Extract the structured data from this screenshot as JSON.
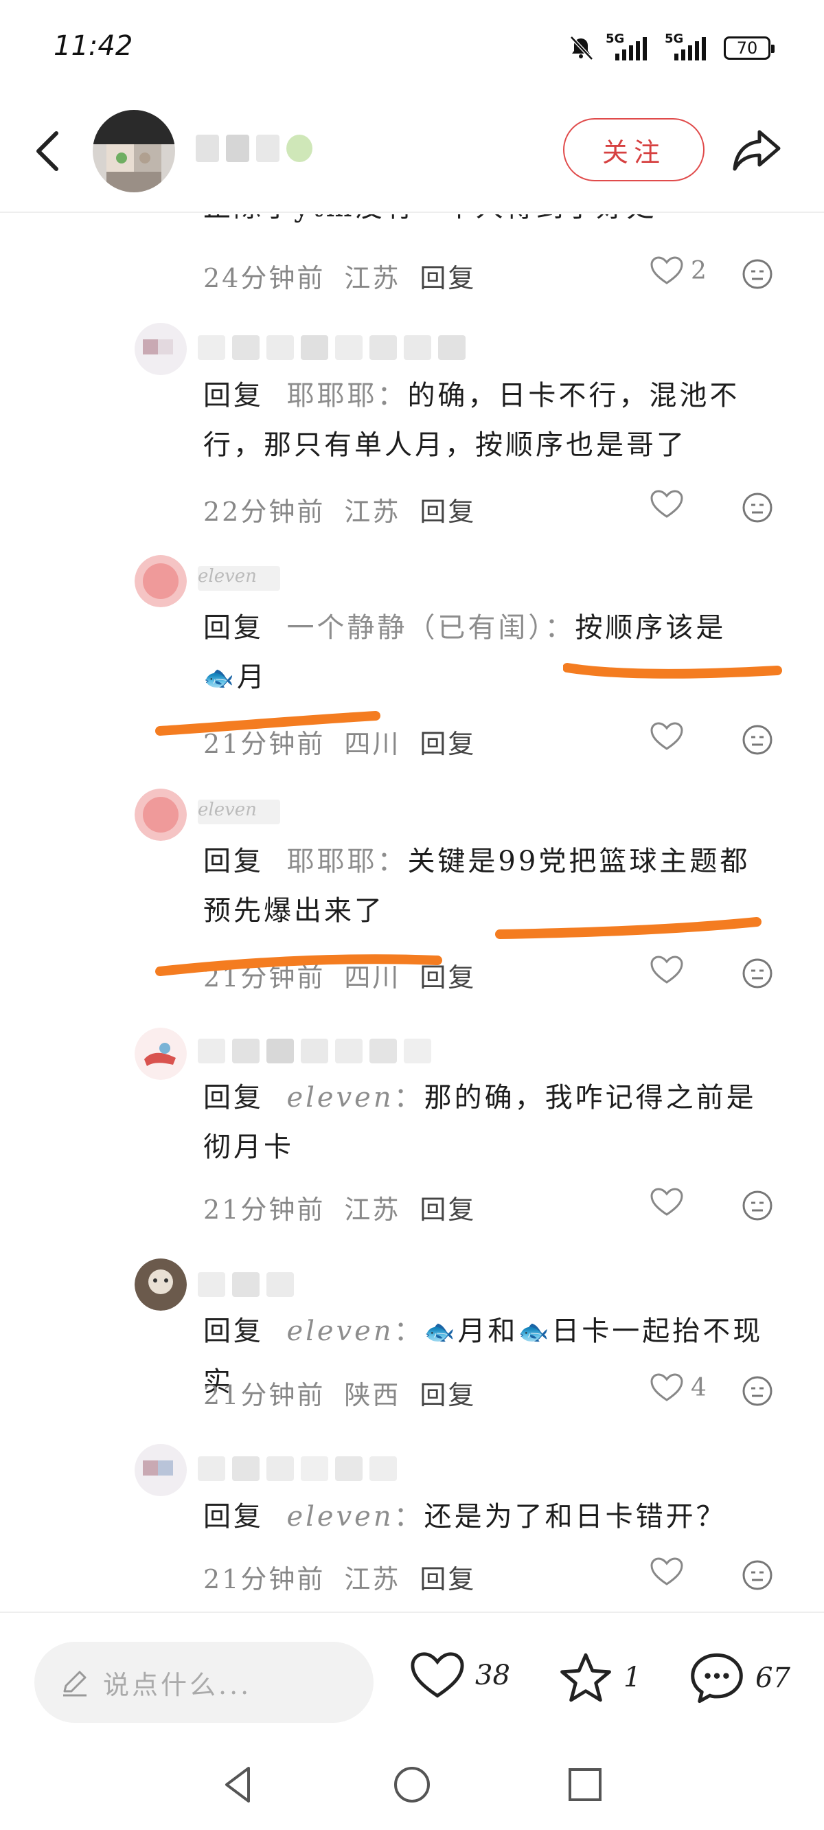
{
  "status": {
    "time": "11:42",
    "network1": "5G",
    "network2": "5G",
    "battery": "70"
  },
  "header": {
    "follow_label": "关注"
  },
  "comments": [
    {
      "text": "止除了ytm没有一个人得到了好处",
      "time": "24分钟前",
      "location": "江苏",
      "reply": "回复",
      "likes": "2"
    },
    {
      "prefix": "回复",
      "reply_to": "耶耶耶",
      "body": "的确，日卡不行，混池不行，那只有单人月，按顺序也是哥了",
      "time": "22分钟前",
      "location": "江苏",
      "reply": "回复"
    },
    {
      "author": "eleven",
      "prefix": "回复",
      "reply_to": "一个静静（已有闺）",
      "body_a": "按顺序该是",
      "body_b": "月",
      "time": "21分钟前",
      "location": "四川",
      "reply": "回复"
    },
    {
      "author": "eleven",
      "prefix": "回复",
      "reply_to": "耶耶耶",
      "body": "关键是99党把篮球主题都预先爆出来了",
      "time": "21分钟前",
      "location": "四川",
      "reply": "回复"
    },
    {
      "prefix": "回复",
      "reply_to": "eleven",
      "body": "那的确，我咋记得之前是彻月卡",
      "time": "21分钟前",
      "location": "江苏",
      "reply": "回复"
    },
    {
      "prefix": "回复",
      "reply_to": "eleven",
      "body_a": "月和",
      "body_b": "日卡一起抬不现实",
      "time": "21分钟前",
      "location": "陕西",
      "reply": "回复",
      "likes": "4"
    },
    {
      "prefix": "回复",
      "reply_to": "eleven",
      "body": "还是为了和日卡错开？",
      "time": "21分钟前",
      "location": "江苏",
      "reply": "回复"
    }
  ],
  "bottom": {
    "placeholder": "说点什么...",
    "likes": "38",
    "stars": "1",
    "comments": "67"
  },
  "icons": [
    "back-icon",
    "share-icon",
    "heart-icon",
    "face-icon",
    "pencil-icon",
    "star-icon",
    "chat-icon",
    "fish-emoji"
  ],
  "colors": {
    "accent_red": "#d64040",
    "highlight": "#f47c20",
    "muted": "#888888"
  }
}
